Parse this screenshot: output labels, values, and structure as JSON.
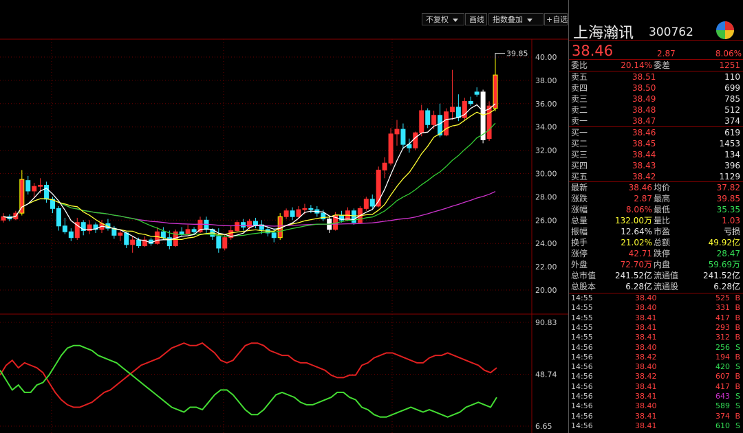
{
  "toolbar": {
    "adjust_label": "不复权",
    "draw_line_label": "画线",
    "index_overlay_label": "指数叠加",
    "watchlist_label": "+自选"
  },
  "chart": {
    "price_axis_labels": [
      "40.00",
      "38.00",
      "36.00",
      "34.00",
      "32.00",
      "30.00",
      "28.00",
      "26.00",
      "24.00",
      "22.00",
      "20.00"
    ],
    "high_annotation": "39.85",
    "indicator_axis_labels": [
      "90.83",
      "48.74",
      "6.65"
    ],
    "colors": {
      "up": "#ff3030",
      "down": "#33e6ff",
      "highlight": "#ffff00",
      "ma5": "#ffffff",
      "ma10": "#ffff33",
      "ma20": "#33cc33",
      "ma60": "#cc33cc",
      "ind1": "#e02020",
      "ind2": "#44dd33"
    }
  },
  "chart_data": {
    "type": "candlestick",
    "y_range": [
      20.0,
      40.0
    ],
    "indicator_range": [
      6.65,
      90.83
    ],
    "candles": [
      [
        26.0,
        26.6,
        25.8,
        26.3
      ],
      [
        26.3,
        26.5,
        25.9,
        26.1
      ],
      [
        26.1,
        26.8,
        26.0,
        26.6
      ],
      [
        26.6,
        30.3,
        26.4,
        29.5
      ],
      [
        29.4,
        29.8,
        28.2,
        28.5
      ],
      [
        28.5,
        29.2,
        28.0,
        28.9
      ],
      [
        28.9,
        29.6,
        28.3,
        29.0
      ],
      [
        29.0,
        29.3,
        27.5,
        27.8
      ],
      [
        27.8,
        28.0,
        26.6,
        27.0
      ],
      [
        27.0,
        27.2,
        25.1,
        25.5
      ],
      [
        25.5,
        26.2,
        24.8,
        25.0
      ],
      [
        25.0,
        25.3,
        24.2,
        24.5
      ],
      [
        24.5,
        26.2,
        24.3,
        25.8
      ],
      [
        25.8,
        26.0,
        24.7,
        25.1
      ],
      [
        25.1,
        26.0,
        24.8,
        25.6
      ],
      [
        25.6,
        25.8,
        24.9,
        25.2
      ],
      [
        25.2,
        26.0,
        24.9,
        25.7
      ],
      [
        25.7,
        26.1,
        25.1,
        25.3
      ],
      [
        25.3,
        25.5,
        24.4,
        24.7
      ],
      [
        24.7,
        25.2,
        24.2,
        24.9
      ],
      [
        24.9,
        25.0,
        23.6,
        23.9
      ],
      [
        23.9,
        24.6,
        23.2,
        24.3
      ],
      [
        24.3,
        24.5,
        23.6,
        23.8
      ],
      [
        23.8,
        24.6,
        23.7,
        24.3
      ],
      [
        24.3,
        24.5,
        23.8,
        24.0
      ],
      [
        24.0,
        25.4,
        23.9,
        25.0
      ],
      [
        25.0,
        25.4,
        24.3,
        24.5
      ],
      [
        24.5,
        25.1,
        23.5,
        23.8
      ],
      [
        23.8,
        25.2,
        23.7,
        25.0
      ],
      [
        25.0,
        25.4,
        24.6,
        24.8
      ],
      [
        24.8,
        25.6,
        24.7,
        25.2
      ],
      [
        25.2,
        25.4,
        24.8,
        25.0
      ],
      [
        25.0,
        26.3,
        24.9,
        26.0
      ],
      [
        26.0,
        26.3,
        24.9,
        25.2
      ],
      [
        25.2,
        25.3,
        24.3,
        24.6
      ],
      [
        24.6,
        25.3,
        23.2,
        23.6
      ],
      [
        23.6,
        24.8,
        23.4,
        24.5
      ],
      [
        24.5,
        25.5,
        24.3,
        25.1
      ],
      [
        25.1,
        26.0,
        25.0,
        25.8
      ],
      [
        25.8,
        26.1,
        25.1,
        25.4
      ],
      [
        25.4,
        26.1,
        25.2,
        25.9
      ],
      [
        25.9,
        26.2,
        25.3,
        25.6
      ],
      [
        25.6,
        26.0,
        24.8,
        25.2
      ],
      [
        25.2,
        25.5,
        24.6,
        24.9
      ],
      [
        24.9,
        25.3,
        24.1,
        24.5
      ],
      [
        24.5,
        26.6,
        24.3,
        26.3
      ],
      [
        26.3,
        27.0,
        26.1,
        26.8
      ],
      [
        26.8,
        27.1,
        26.0,
        26.3
      ],
      [
        26.3,
        27.2,
        26.2,
        26.9
      ],
      [
        26.9,
        27.4,
        26.5,
        27.0
      ],
      [
        27.0,
        27.3,
        26.6,
        26.9
      ],
      [
        26.9,
        27.2,
        26.3,
        26.6
      ],
      [
        26.6,
        26.9,
        25.9,
        26.1
      ],
      [
        26.1,
        26.4,
        24.9,
        25.2
      ],
      [
        25.2,
        26.7,
        25.1,
        26.4
      ],
      [
        26.4,
        26.8,
        25.8,
        26.0
      ],
      [
        26.0,
        27.1,
        25.9,
        26.8
      ],
      [
        26.8,
        27.0,
        25.6,
        25.8
      ],
      [
        25.8,
        27.2,
        25.7,
        27.0
      ],
      [
        27.0,
        28.0,
        26.8,
        27.8
      ],
      [
        27.8,
        28.2,
        27.0,
        27.2
      ],
      [
        27.2,
        30.6,
        27.1,
        30.3
      ],
      [
        30.3,
        31.4,
        29.6,
        30.9
      ],
      [
        30.9,
        33.9,
        30.7,
        33.4
      ],
      [
        33.4,
        34.6,
        32.4,
        33.8
      ],
      [
        33.8,
        34.3,
        32.1,
        32.5
      ],
      [
        32.5,
        33.0,
        31.8,
        32.2
      ],
      [
        32.2,
        33.6,
        32.0,
        33.5
      ],
      [
        33.5,
        35.9,
        33.2,
        35.4
      ],
      [
        35.4,
        35.6,
        33.9,
        34.2
      ],
      [
        34.2,
        35.4,
        33.8,
        35.0
      ],
      [
        35.0,
        36.0,
        33.1,
        33.3
      ],
      [
        33.3,
        35.6,
        33.2,
        35.3
      ],
      [
        35.3,
        38.9,
        34.6,
        35.7
      ],
      [
        35.7,
        36.8,
        34.5,
        34.8
      ],
      [
        34.8,
        36.5,
        34.6,
        36.2
      ],
      [
        36.2,
        36.6,
        35.8,
        36.0
      ],
      [
        37.0,
        37.4,
        36.6,
        36.8
      ],
      [
        37.0,
        37.2,
        32.6,
        32.9
      ],
      [
        33.0,
        36.2,
        32.8,
        35.8
      ],
      [
        35.6,
        39.85,
        35.35,
        38.46
      ]
    ],
    "indicator_lines": {
      "line1": [
        48,
        56,
        60,
        54,
        58,
        56,
        54,
        50,
        42,
        34,
        28,
        24,
        22,
        22,
        24,
        26,
        30,
        34,
        36,
        40,
        44,
        48,
        52,
        56,
        58,
        60,
        62,
        66,
        70,
        72,
        74,
        72,
        72,
        74,
        70,
        66,
        60,
        58,
        60,
        66,
        72,
        74,
        74,
        72,
        68,
        66,
        64,
        64,
        60,
        58,
        58,
        56,
        54,
        52,
        48,
        46,
        46,
        48,
        48,
        56,
        58,
        62,
        64,
        66,
        66,
        64,
        62,
        60,
        58,
        58,
        62,
        64,
        64,
        66,
        64,
        62,
        60,
        58,
        56,
        52,
        50,
        54
      ],
      "line2": [
        52,
        44,
        36,
        40,
        34,
        34,
        40,
        42,
        48,
        56,
        64,
        70,
        72,
        72,
        70,
        68,
        64,
        62,
        60,
        58,
        54,
        50,
        46,
        42,
        38,
        34,
        30,
        26,
        22,
        20,
        18,
        22,
        22,
        20,
        26,
        32,
        36,
        36,
        32,
        26,
        20,
        16,
        16,
        20,
        26,
        32,
        34,
        32,
        30,
        26,
        24,
        24,
        26,
        28,
        30,
        34,
        34,
        30,
        28,
        22,
        20,
        16,
        14,
        14,
        16,
        18,
        20,
        22,
        20,
        18,
        20,
        18,
        16,
        14,
        16,
        18,
        22,
        24,
        26,
        24,
        22,
        30
      ]
    }
  },
  "quote": {
    "name": "上海瀚讯",
    "code": "300762",
    "price": "38.46",
    "change": "2.87",
    "change_pct": "8.06%",
    "wb_label": "委比",
    "wb_value": "20.14%",
    "wc_label": "委差",
    "wc_value": "1251",
    "asks": [
      {
        "label": "卖五",
        "price": "38.51",
        "vol": "110"
      },
      {
        "label": "卖四",
        "price": "38.50",
        "vol": "699"
      },
      {
        "label": "卖三",
        "price": "38.49",
        "vol": "785"
      },
      {
        "label": "卖二",
        "price": "38.48",
        "vol": "512"
      },
      {
        "label": "卖一",
        "price": "38.47",
        "vol": "374"
      }
    ],
    "bids": [
      {
        "label": "买一",
        "price": "38.46",
        "vol": "619"
      },
      {
        "label": "买二",
        "price": "38.45",
        "vol": "1453"
      },
      {
        "label": "买三",
        "price": "38.44",
        "vol": "134"
      },
      {
        "label": "买四",
        "price": "38.43",
        "vol": "396"
      },
      {
        "label": "买五",
        "price": "38.42",
        "vol": "1129"
      }
    ],
    "stats": [
      {
        "l1": "最新",
        "v1": "38.46",
        "c1": "red",
        "l2": "均价",
        "v2": "37.82",
        "c2": "red"
      },
      {
        "l1": "涨跌",
        "v1": "2.87",
        "c1": "red",
        "l2": "最高",
        "v2": "39.85",
        "c2": "red"
      },
      {
        "l1": "涨幅",
        "v1": "8.06%",
        "c1": "red",
        "l2": "最低",
        "v2": "35.35",
        "c2": "green"
      },
      {
        "l1": "总量",
        "v1": "132.00万",
        "c1": "yellow",
        "l2": "量比",
        "v2": "1.03",
        "c2": "red"
      },
      {
        "l1": "振幅",
        "v1": "12.64%",
        "c1": "white",
        "l2": "市盈",
        "v2": "亏损",
        "c2": "white"
      },
      {
        "l1": "换手",
        "v1": "21.02%",
        "c1": "yellow",
        "l2": "总额",
        "v2": "49.92亿",
        "c2": "yellow"
      },
      {
        "l1": "涨停",
        "v1": "42.71",
        "c1": "red",
        "l2": "跌停",
        "v2": "28.47",
        "c2": "green"
      },
      {
        "l1": "外盘",
        "v1": "72.70万",
        "c1": "red",
        "l2": "内盘",
        "v2": "59.69万",
        "c2": "green"
      },
      {
        "l1": "总市值",
        "v1": "241.52亿",
        "c1": "white",
        "l2": "流通值",
        "v2": "241.52亿",
        "c2": "white"
      },
      {
        "l1": "总股本",
        "v1": "6.28亿",
        "c1": "white",
        "l2": "流通股",
        "v2": "6.28亿",
        "c2": "white"
      }
    ],
    "ticks": [
      {
        "time": "14:55",
        "price": "38.40",
        "vol": "525",
        "side": "B",
        "vc": "red"
      },
      {
        "time": "14:55",
        "price": "38.40",
        "vol": "331",
        "side": "B",
        "vc": "red"
      },
      {
        "time": "14:55",
        "price": "38.41",
        "vol": "417",
        "side": "B",
        "vc": "red"
      },
      {
        "time": "14:55",
        "price": "38.41",
        "vol": "293",
        "side": "B",
        "vc": "red"
      },
      {
        "time": "14:55",
        "price": "38.41",
        "vol": "312",
        "side": "B",
        "vc": "red"
      },
      {
        "time": "14:56",
        "price": "38.40",
        "vol": "256",
        "side": "S",
        "vc": "green"
      },
      {
        "time": "14:56",
        "price": "38.42",
        "vol": "194",
        "side": "B",
        "vc": "red"
      },
      {
        "time": "14:56",
        "price": "38.40",
        "vol": "420",
        "side": "S",
        "vc": "green"
      },
      {
        "time": "14:56",
        "price": "38.42",
        "vol": "607",
        "side": "B",
        "vc": "red"
      },
      {
        "time": "14:56",
        "price": "38.41",
        "vol": "417",
        "side": "B",
        "vc": "red"
      },
      {
        "time": "14:56",
        "price": "38.41",
        "vol": "643",
        "side": "S",
        "vc": "purple"
      },
      {
        "time": "14:56",
        "price": "38.40",
        "vol": "589",
        "side": "S",
        "vc": "green"
      },
      {
        "time": "14:56",
        "price": "38.41",
        "vol": "374",
        "side": "B",
        "vc": "red"
      },
      {
        "time": "14:56",
        "price": "38.41",
        "vol": "610",
        "side": "S",
        "vc": "green"
      }
    ]
  }
}
